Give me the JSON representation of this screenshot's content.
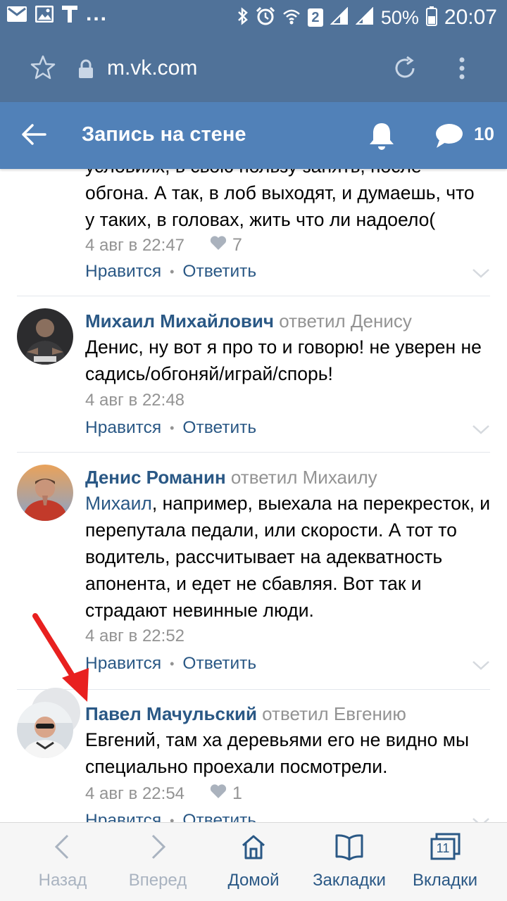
{
  "status_bar": {
    "dots": "...",
    "sim_slot": "2",
    "battery": "50%",
    "time": "20:07"
  },
  "browser": {
    "url": "m.vk.com"
  },
  "header": {
    "title": "Запись на стене",
    "message_count": "10"
  },
  "comments": [
    {
      "text_lines": [
        "условиях, в свою пользу занять, после",
        "обгона. А так, в лоб выходят, и думаешь, что",
        "у таких, в головах, жить что ли надоело("
      ],
      "date": "4 авг в 22:47",
      "likes": "7",
      "like_label": "Нравится",
      "reply_label": "Ответить"
    },
    {
      "author": "Михаил Михайлович",
      "replied": "ответил Денису",
      "text": "Денис, ну вот я про то и говорю! не уверен не садись/обгоняй/играй/спорь!",
      "date": "4 авг в 22:48",
      "like_label": "Нравится",
      "reply_label": "Ответить"
    },
    {
      "author": "Денис Романин",
      "replied": "ответил Михаилу",
      "mention": "Михаил",
      "text": ", например, выехала на перекресток, и перепутала педали, или скорости. А тот то водитель, рассчитывает на адекватность апонента, и едет не сбавляя. Вот так и страдают невинные люди.",
      "date": "4 авг в 22:52",
      "like_label": "Нравится",
      "reply_label": "Ответить"
    },
    {
      "author": "Павел Мачульский",
      "replied": "ответил Евгению",
      "text": "Евгений, там ха деревьями его не видно мы специально проехали посмотрели.",
      "date": "4 авг в 22:54",
      "likes": "1",
      "like_label": "Нравится",
      "reply_label": "Ответить"
    }
  ],
  "bottom_nav": {
    "back": "Назад",
    "forward": "Вперед",
    "home": "Домой",
    "bookmarks": "Закладки",
    "tabs": "Вкладки",
    "tabs_count": "11"
  },
  "colors": {
    "status_bg": "#507299",
    "header_bg": "#5181b8",
    "link": "#2a5885",
    "muted": "#939393",
    "annotation_arrow": "#e8201f"
  }
}
